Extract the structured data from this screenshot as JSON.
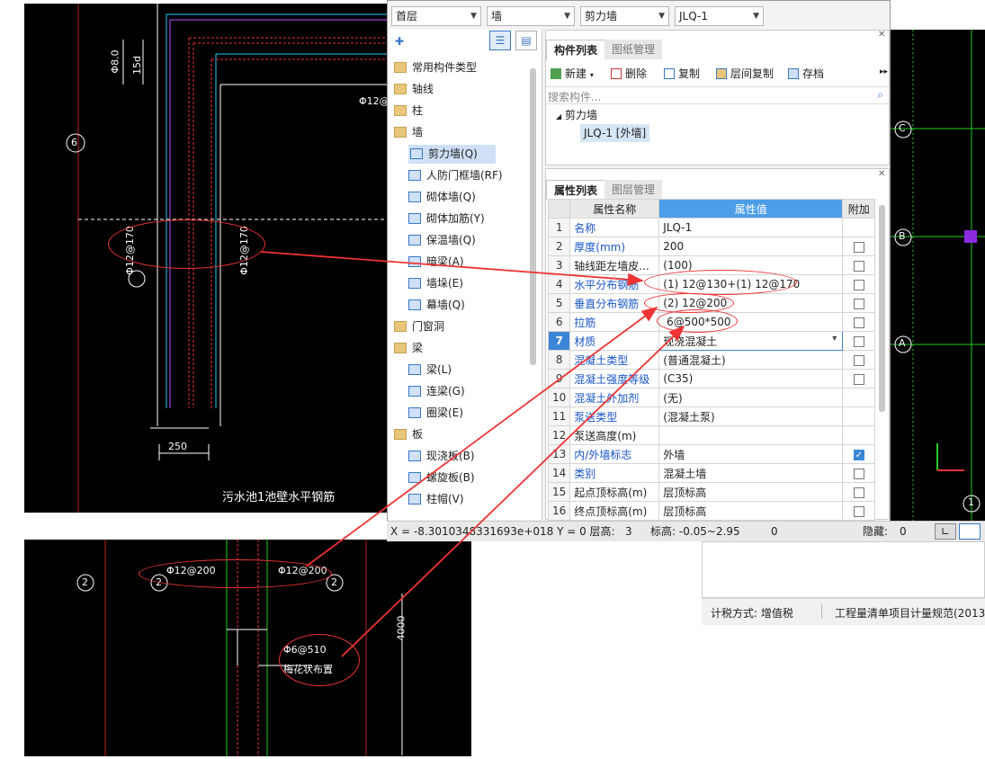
{
  "toolbar": {
    "floor": "首层",
    "category": "墙",
    "type": "剪力墙",
    "component": "JLQ-1"
  },
  "tree": {
    "items": [
      {
        "label": "常用构件类型",
        "kind": "folder"
      },
      {
        "label": "轴线",
        "kind": "folder"
      },
      {
        "label": "柱",
        "kind": "folder"
      },
      {
        "label": "墙",
        "kind": "folder-open"
      },
      {
        "label": "剪力墙(Q)",
        "kind": "child",
        "selected": true
      },
      {
        "label": "人防门框墙(RF)",
        "kind": "child"
      },
      {
        "label": "砌体墙(Q)",
        "kind": "child"
      },
      {
        "label": "砌体加筋(Y)",
        "kind": "child"
      },
      {
        "label": "保温墙(Q)",
        "kind": "child"
      },
      {
        "label": "暗梁(A)",
        "kind": "child"
      },
      {
        "label": "墙垛(E)",
        "kind": "child"
      },
      {
        "label": "幕墙(Q)",
        "kind": "child"
      },
      {
        "label": "门窗洞",
        "kind": "folder"
      },
      {
        "label": "梁",
        "kind": "folder-open"
      },
      {
        "label": "梁(L)",
        "kind": "child"
      },
      {
        "label": "连梁(G)",
        "kind": "child"
      },
      {
        "label": "圈梁(E)",
        "kind": "child"
      },
      {
        "label": "板",
        "kind": "folder-open"
      },
      {
        "label": "现浇板(B)",
        "kind": "child"
      },
      {
        "label": "螺旋板(B)",
        "kind": "child"
      },
      {
        "label": "柱帽(V)",
        "kind": "child"
      }
    ]
  },
  "components": {
    "tabs": [
      "构件列表",
      "图纸管理"
    ],
    "actions": [
      "新建",
      "删除",
      "复制",
      "层间复制",
      "存档"
    ],
    "search_placeholder": "搜索构件...",
    "group": "剪力墙",
    "item": "JLQ-1 [外墙]"
  },
  "properties": {
    "tabs": [
      "属性列表",
      "图层管理"
    ],
    "headers": [
      "属性名称",
      "属性值",
      "附加"
    ],
    "rows": [
      {
        "n": "1",
        "name": "名称",
        "value": "JLQ-1",
        "check": null
      },
      {
        "n": "2",
        "name": "厚度(mm)",
        "value": "200",
        "check": false
      },
      {
        "n": "3",
        "name": "轴线距左墙皮...",
        "value": "(100)",
        "check": false
      },
      {
        "n": "4",
        "name": "水平分布钢筋",
        "value": "(1) 12@130+(1) 12@170",
        "check": false
      },
      {
        "n": "5",
        "name": "垂直分布钢筋",
        "value": "(2) 12@200",
        "check": false
      },
      {
        "n": "6",
        "name": "拉筋",
        "value": " 6@500*500",
        "check": false
      },
      {
        "n": "7",
        "name": "材质",
        "value": "现浇混凝土",
        "check": false
      },
      {
        "n": "8",
        "name": "混凝土类型",
        "value": "(普通混凝土)",
        "check": false
      },
      {
        "n": "9",
        "name": "混凝土强度等级",
        "value": "(C35)",
        "check": false
      },
      {
        "n": "10",
        "name": "混凝土外加剂",
        "value": "(无)",
        "check": null
      },
      {
        "n": "11",
        "name": "泵送类型",
        "value": "(混凝土泵)",
        "check": null
      },
      {
        "n": "12",
        "name": "泵送高度(m)",
        "value": "",
        "check": null
      },
      {
        "n": "13",
        "name": "内/外墙标志",
        "value": "外墙",
        "check": true
      },
      {
        "n": "14",
        "name": "类别",
        "value": "混凝土墙",
        "check": false
      },
      {
        "n": "15",
        "name": "起点顶标高(m)",
        "value": "层顶标高",
        "check": false
      },
      {
        "n": "16",
        "name": "终点顶标高(m)",
        "value": "层顶标高",
        "check": false
      }
    ]
  },
  "status": {
    "coords": "X = -8.3010348331693e+018 Y = 0 层高:   3",
    "elevation": "标高: -0.05~2.95",
    "count": "0",
    "hidden_label": "隐藏:",
    "hidden_value": "0"
  },
  "bottom_bar": {
    "tax": "计税方式: 增值税",
    "rule": "工程量清单项目计量规范(2013-"
  },
  "cad_top": {
    "caption": "污水池1池壁水平钢筋",
    "dim_250": "250",
    "rebar_left": "Φ12@170",
    "rebar_right": "Φ12@170",
    "rebar_top": "Φ12@",
    "axis_6": "6",
    "dim_lab": "Φ8.0",
    "dim_15d": "15d"
  },
  "cad_bottom": {
    "axis_2a": "2",
    "axis_2b": "2",
    "axis_2c": "2",
    "rebar_a": "Φ12@200",
    "rebar_b": "Φ12@200",
    "tie": "Φ6@510",
    "tie_note": "梅花状布置",
    "dim_4000": "4000"
  },
  "cad_right": {
    "axes": [
      "C",
      "B",
      "A",
      "1"
    ]
  }
}
